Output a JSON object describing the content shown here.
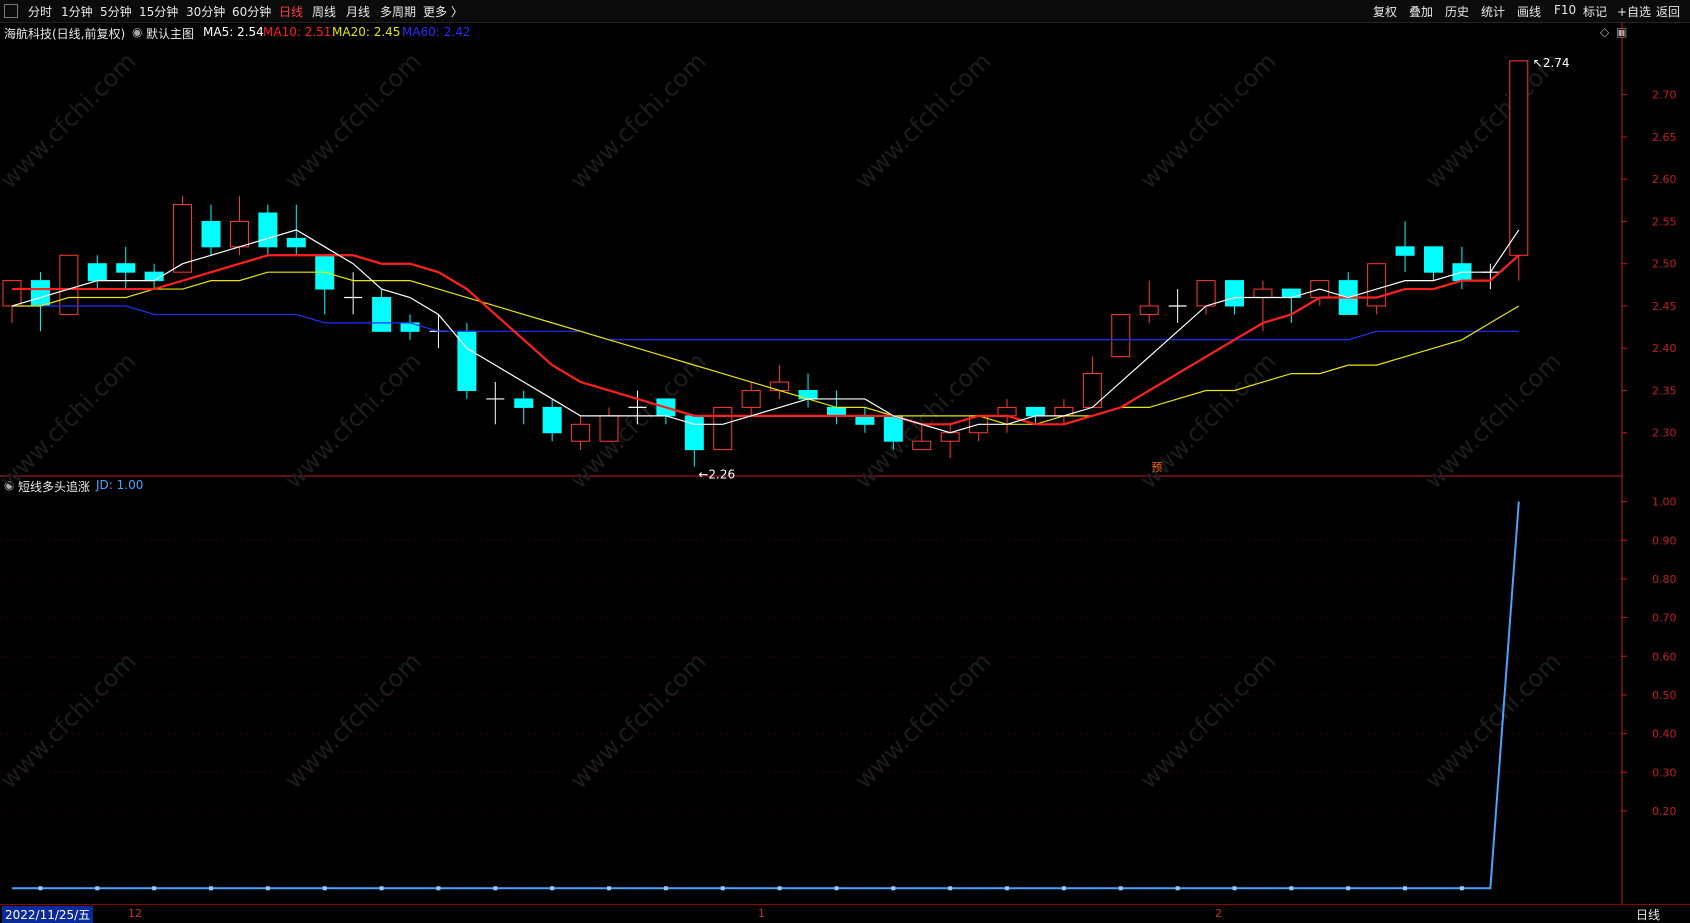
{
  "toolbar": {
    "periods": [
      "分时",
      "1分钟",
      "5分钟",
      "15分钟",
      "30分钟",
      "60分钟",
      "日线",
      "周线",
      "月线",
      "多周期",
      "更多 〉"
    ],
    "active_period": "日线",
    "right_items": [
      "复权",
      "叠加",
      "历史",
      "统计",
      "画线",
      "F10",
      "标记",
      "+自选",
      "返回"
    ]
  },
  "main_legend": {
    "stock": "海航科技(日线,前复权)",
    "template": "默认主图",
    "ma5": "MA5: 2.54",
    "ma10": "MA10: 2.51",
    "ma20": "MA20: 2.45",
    "ma60": "MA60: 2.42"
  },
  "indicator_legend": {
    "name": "短线多头追涨",
    "jd": "JD: 1.00"
  },
  "annotations": {
    "high": "2.74",
    "low": "2.26",
    "yu": "预"
  },
  "bottom": {
    "date": "2022/11/25/五",
    "month_labels": [
      "12",
      "1",
      "2"
    ],
    "period_btn": "日线"
  },
  "colors": {
    "up": "#ff3b3b",
    "down": "#00ffff",
    "ma5": "#ffffff",
    "ma10": "#ff2020",
    "ma20": "#e6e600",
    "ma60": "#2030ff",
    "jd": "#4aa3ff",
    "axis": "#c02020"
  },
  "chart_data": [
    {
      "type": "candlestick",
      "title": "海航科技(日线,前复权)",
      "yticks": [
        2.3,
        2.35,
        2.4,
        2.45,
        2.5,
        2.55,
        2.6,
        2.65,
        2.7
      ],
      "ylim": [
        2.25,
        2.76
      ],
      "candles": [
        {
          "o": 2.45,
          "c": 2.48,
          "h": 2.48,
          "l": 2.43
        },
        {
          "o": 2.48,
          "c": 2.45,
          "h": 2.49,
          "l": 2.42
        },
        {
          "o": 2.44,
          "c": 2.51,
          "h": 2.51,
          "l": 2.44
        },
        {
          "o": 2.5,
          "c": 2.48,
          "h": 2.51,
          "l": 2.47
        },
        {
          "o": 2.5,
          "c": 2.49,
          "h": 2.52,
          "l": 2.47
        },
        {
          "o": 2.49,
          "c": 2.48,
          "h": 2.5,
          "l": 2.47
        },
        {
          "o": 2.49,
          "c": 2.57,
          "h": 2.58,
          "l": 2.49
        },
        {
          "o": 2.55,
          "c": 2.52,
          "h": 2.57,
          "l": 2.51
        },
        {
          "o": 2.52,
          "c": 2.55,
          "h": 2.58,
          "l": 2.51
        },
        {
          "o": 2.56,
          "c": 2.52,
          "h": 2.57,
          "l": 2.51
        },
        {
          "o": 2.53,
          "c": 2.52,
          "h": 2.57,
          "l": 2.51
        },
        {
          "o": 2.51,
          "c": 2.47,
          "h": 2.51,
          "l": 2.44
        },
        {
          "o": 2.46,
          "c": 2.46,
          "h": 2.49,
          "l": 2.44
        },
        {
          "o": 2.46,
          "c": 2.42,
          "h": 2.47,
          "l": 2.42
        },
        {
          "o": 2.43,
          "c": 2.42,
          "h": 2.44,
          "l": 2.41
        },
        {
          "o": 2.42,
          "c": 2.42,
          "h": 2.44,
          "l": 2.4
        },
        {
          "o": 2.42,
          "c": 2.35,
          "h": 2.43,
          "l": 2.34
        },
        {
          "o": 2.34,
          "c": 2.34,
          "h": 2.36,
          "l": 2.31
        },
        {
          "o": 2.34,
          "c": 2.33,
          "h": 2.35,
          "l": 2.31
        },
        {
          "o": 2.33,
          "c": 2.3,
          "h": 2.34,
          "l": 2.29
        },
        {
          "o": 2.29,
          "c": 2.31,
          "h": 2.32,
          "l": 2.28
        },
        {
          "o": 2.29,
          "c": 2.32,
          "h": 2.33,
          "l": 2.29
        },
        {
          "o": 2.33,
          "c": 2.33,
          "h": 2.35,
          "l": 2.31
        },
        {
          "o": 2.34,
          "c": 2.32,
          "h": 2.34,
          "l": 2.31
        },
        {
          "o": 2.32,
          "c": 2.28,
          "h": 2.32,
          "l": 2.26
        },
        {
          "o": 2.28,
          "c": 2.33,
          "h": 2.33,
          "l": 2.28
        },
        {
          "o": 2.33,
          "c": 2.35,
          "h": 2.36,
          "l": 2.32
        },
        {
          "o": 2.35,
          "c": 2.36,
          "h": 2.38,
          "l": 2.34
        },
        {
          "o": 2.35,
          "c": 2.34,
          "h": 2.37,
          "l": 2.33
        },
        {
          "o": 2.33,
          "c": 2.32,
          "h": 2.35,
          "l": 2.31
        },
        {
          "o": 2.32,
          "c": 2.31,
          "h": 2.33,
          "l": 2.3
        },
        {
          "o": 2.32,
          "c": 2.29,
          "h": 2.32,
          "l": 2.28
        },
        {
          "o": 2.28,
          "c": 2.29,
          "h": 2.31,
          "l": 2.28
        },
        {
          "o": 2.29,
          "c": 2.3,
          "h": 2.31,
          "l": 2.27
        },
        {
          "o": 2.3,
          "c": 2.32,
          "h": 2.32,
          "l": 2.29
        },
        {
          "o": 2.32,
          "c": 2.33,
          "h": 2.34,
          "l": 2.3
        },
        {
          "o": 2.33,
          "c": 2.32,
          "h": 2.33,
          "l": 2.31
        },
        {
          "o": 2.32,
          "c": 2.33,
          "h": 2.34,
          "l": 2.31
        },
        {
          "o": 2.33,
          "c": 2.37,
          "h": 2.39,
          "l": 2.33
        },
        {
          "o": 2.39,
          "c": 2.44,
          "h": 2.44,
          "l": 2.39
        },
        {
          "o": 2.44,
          "c": 2.45,
          "h": 2.48,
          "l": 2.43
        },
        {
          "o": 2.45,
          "c": 2.45,
          "h": 2.47,
          "l": 2.43
        },
        {
          "o": 2.45,
          "c": 2.48,
          "h": 2.48,
          "l": 2.44
        },
        {
          "o": 2.48,
          "c": 2.45,
          "h": 2.48,
          "l": 2.44
        },
        {
          "o": 2.46,
          "c": 2.47,
          "h": 2.48,
          "l": 2.42
        },
        {
          "o": 2.47,
          "c": 2.46,
          "h": 2.47,
          "l": 2.43
        },
        {
          "o": 2.46,
          "c": 2.48,
          "h": 2.48,
          "l": 2.45
        },
        {
          "o": 2.48,
          "c": 2.44,
          "h": 2.49,
          "l": 2.44
        },
        {
          "o": 2.45,
          "c": 2.5,
          "h": 2.5,
          "l": 2.44
        },
        {
          "o": 2.52,
          "c": 2.51,
          "h": 2.55,
          "l": 2.49
        },
        {
          "o": 2.52,
          "c": 2.49,
          "h": 2.52,
          "l": 2.48
        },
        {
          "o": 2.5,
          "c": 2.48,
          "h": 2.52,
          "l": 2.47
        },
        {
          "o": 2.49,
          "c": 2.49,
          "h": 2.5,
          "l": 2.47
        },
        {
          "o": 2.51,
          "c": 2.74,
          "h": 2.74,
          "l": 2.48
        }
      ],
      "ma5": [
        2.45,
        2.46,
        2.47,
        2.48,
        2.48,
        2.48,
        2.5,
        2.51,
        2.52,
        2.53,
        2.54,
        2.52,
        2.5,
        2.47,
        2.46,
        2.44,
        2.4,
        2.38,
        2.36,
        2.34,
        2.32,
        2.32,
        2.32,
        2.32,
        2.31,
        2.31,
        2.32,
        2.33,
        2.34,
        2.34,
        2.34,
        2.32,
        2.31,
        2.3,
        2.31,
        2.31,
        2.32,
        2.32,
        2.33,
        2.36,
        2.39,
        2.42,
        2.45,
        2.46,
        2.46,
        2.46,
        2.47,
        2.46,
        2.47,
        2.48,
        2.48,
        2.49,
        2.49,
        2.54
      ],
      "ma10": [
        2.47,
        2.47,
        2.47,
        2.47,
        2.47,
        2.47,
        2.48,
        2.49,
        2.5,
        2.51,
        2.51,
        2.51,
        2.51,
        2.5,
        2.5,
        2.49,
        2.47,
        2.44,
        2.41,
        2.38,
        2.36,
        2.35,
        2.34,
        2.33,
        2.32,
        2.32,
        2.32,
        2.32,
        2.32,
        2.32,
        2.32,
        2.32,
        2.31,
        2.31,
        2.32,
        2.32,
        2.31,
        2.31,
        2.32,
        2.33,
        2.35,
        2.37,
        2.39,
        2.41,
        2.43,
        2.44,
        2.46,
        2.46,
        2.46,
        2.47,
        2.47,
        2.48,
        2.48,
        2.51
      ],
      "ma20": [
        2.45,
        2.45,
        2.46,
        2.46,
        2.46,
        2.47,
        2.47,
        2.48,
        2.48,
        2.49,
        2.49,
        2.49,
        2.48,
        2.48,
        2.48,
        2.47,
        2.46,
        2.45,
        2.44,
        2.43,
        2.42,
        2.41,
        2.4,
        2.39,
        2.38,
        2.37,
        2.36,
        2.35,
        2.34,
        2.33,
        2.33,
        2.32,
        2.32,
        2.32,
        2.32,
        2.31,
        2.31,
        2.32,
        2.32,
        2.33,
        2.33,
        2.34,
        2.35,
        2.35,
        2.36,
        2.37,
        2.37,
        2.38,
        2.38,
        2.39,
        2.4,
        2.41,
        2.43,
        2.45
      ],
      "ma60": [
        2.45,
        2.45,
        2.45,
        2.45,
        2.45,
        2.44,
        2.44,
        2.44,
        2.44,
        2.44,
        2.44,
        2.43,
        2.43,
        2.43,
        2.43,
        2.42,
        2.42,
        2.42,
        2.42,
        2.42,
        2.42,
        2.41,
        2.41,
        2.41,
        2.41,
        2.41,
        2.41,
        2.41,
        2.41,
        2.41,
        2.41,
        2.41,
        2.41,
        2.41,
        2.41,
        2.41,
        2.41,
        2.41,
        2.41,
        2.41,
        2.41,
        2.41,
        2.41,
        2.41,
        2.41,
        2.41,
        2.41,
        2.41,
        2.42,
        2.42,
        2.42,
        2.42,
        2.42,
        2.42
      ]
    },
    {
      "type": "line",
      "title": "短线多头追涨",
      "series": [
        {
          "name": "JD",
          "values": [
            0,
            0,
            0,
            0,
            0,
            0,
            0,
            0,
            0,
            0,
            0,
            0,
            0,
            0,
            0,
            0,
            0,
            0,
            0,
            0,
            0,
            0,
            0,
            0,
            0,
            0,
            0,
            0,
            0,
            0,
            0,
            0,
            0,
            0,
            0,
            0,
            0,
            0,
            0,
            0,
            0,
            0,
            0,
            0,
            0,
            0,
            0,
            0,
            0,
            0,
            0,
            0,
            0,
            1.0
          ]
        }
      ],
      "yticks": [
        0.2,
        0.3,
        0.4,
        0.5,
        0.6,
        0.7,
        0.8,
        0.9,
        1.0
      ],
      "ylim": [
        -0.02,
        1.03
      ]
    }
  ]
}
